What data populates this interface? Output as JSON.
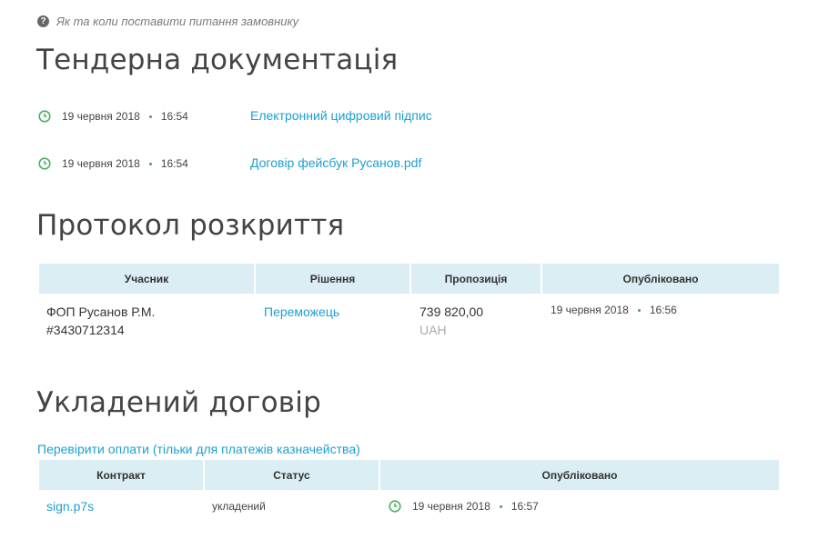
{
  "help": {
    "text": "Як та коли поставити питання замовнику"
  },
  "tender_docs": {
    "title": "Тендерна документація",
    "items": [
      {
        "date": "19 червня 2018",
        "time": "16:54",
        "name": "Електронний цифровий підпис"
      },
      {
        "date": "19 червня 2018",
        "time": "16:54",
        "name": "Договір фейсбук Русанов.pdf"
      }
    ]
  },
  "protocol": {
    "title": "Протокол розкриття",
    "headers": [
      "Учасник",
      "Рішення",
      "Пропозиція",
      "Опубліковано"
    ],
    "row": {
      "participant_name": "ФОП Русанов Р.М.",
      "participant_id": "#3430712314",
      "decision": "Переможець",
      "amount": "739 820,00",
      "currency": "UAH",
      "date": "19 червня 2018",
      "time": "16:56"
    }
  },
  "contract": {
    "title": "Укладений договір",
    "check_link": "Перевірити оплати (тільки для платежів казначейства)",
    "headers": [
      "Контракт",
      "Статус",
      "Опубліковано"
    ],
    "row": {
      "file": "sign.p7s",
      "status": "укладений",
      "date": "19 червня 2018",
      "time": "16:57"
    }
  },
  "colors": {
    "link": "#1e9fd1",
    "header_bg": "#daeef3",
    "clock": "#4caf64"
  }
}
